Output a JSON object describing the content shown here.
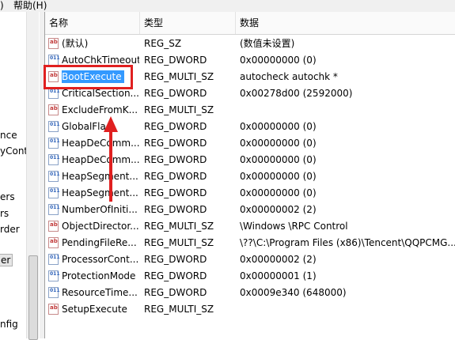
{
  "menubar": {
    "items": [
      {
        "label": ")"
      },
      {
        "label": "帮助(H)"
      }
    ]
  },
  "tree": {
    "items": [
      {
        "label": "nce"
      },
      {
        "label": "yCont"
      },
      {
        "label": "ers"
      },
      {
        "label": "rs"
      },
      {
        "label": "rder"
      },
      {
        "label": "er",
        "selected": true
      },
      {
        "label": "nfig"
      }
    ]
  },
  "list": {
    "columns": {
      "name": "名称",
      "type": "类型",
      "data": "数据"
    },
    "rows": [
      {
        "name": "(默认)",
        "type": "REG_SZ",
        "data": "(数值未设置)",
        "icon": "string-value-icon"
      },
      {
        "name": "AutoChkTimeout",
        "type": "REG_DWORD",
        "data": "0x00000000 (0)",
        "icon": "binary-value-icon"
      },
      {
        "name": "BootExecute",
        "type": "REG_MULTI_SZ",
        "data": "autocheck autochk *",
        "icon": "string-value-icon",
        "selected": true
      },
      {
        "name": "CriticalSection...",
        "type": "REG_DWORD",
        "data": "0x00278d00 (2592000)",
        "icon": "binary-value-icon"
      },
      {
        "name": "ExcludeFromK...",
        "type": "REG_MULTI_SZ",
        "data": "",
        "icon": "string-value-icon"
      },
      {
        "name": "GlobalFla",
        "type": "REG_DWORD",
        "data": "0x00000000 (0)",
        "icon": "binary-value-icon"
      },
      {
        "name": "HeapDeComm...",
        "type": "REG_DWORD",
        "data": "0x00000000 (0)",
        "icon": "binary-value-icon"
      },
      {
        "name": "HeapDeComm...",
        "type": "REG_DWORD",
        "data": "0x00000000 (0)",
        "icon": "binary-value-icon"
      },
      {
        "name": "HeapSegment...",
        "type": "REG_DWORD",
        "data": "0x00000000 (0)",
        "icon": "binary-value-icon"
      },
      {
        "name": "HeapSegment...",
        "type": "REG_DWORD",
        "data": "0x00000000 (0)",
        "icon": "binary-value-icon"
      },
      {
        "name": "NumberOfIniti...",
        "type": "REG_DWORD",
        "data": "0x00000002 (2)",
        "icon": "binary-value-icon"
      },
      {
        "name": "ObjectDirector...",
        "type": "REG_MULTI_SZ",
        "data": "\\Windows \\RPC Control",
        "icon": "string-value-icon"
      },
      {
        "name": "PendingFileRe...",
        "type": "REG_MULTI_SZ",
        "data": "\\??\\C:\\Program Files (x86)\\Tencent\\QQPCMG...",
        "icon": "string-value-icon"
      },
      {
        "name": "ProcessorCont...",
        "type": "REG_DWORD",
        "data": "0x00000002 (2)",
        "icon": "binary-value-icon"
      },
      {
        "name": "ProtectionMode",
        "type": "REG_DWORD",
        "data": "0x00000001 (1)",
        "icon": "binary-value-icon"
      },
      {
        "name": "ResourceTime...",
        "type": "REG_DWORD",
        "data": "0x0009e340 (648000)",
        "icon": "binary-value-icon"
      },
      {
        "name": "SetupExecute",
        "type": "REG_MULTI_SZ",
        "data": "",
        "icon": "string-value-icon"
      }
    ]
  },
  "colors": {
    "selection": "#3399ff",
    "highlight_box": "#e02020",
    "arrow": "#e02020"
  }
}
